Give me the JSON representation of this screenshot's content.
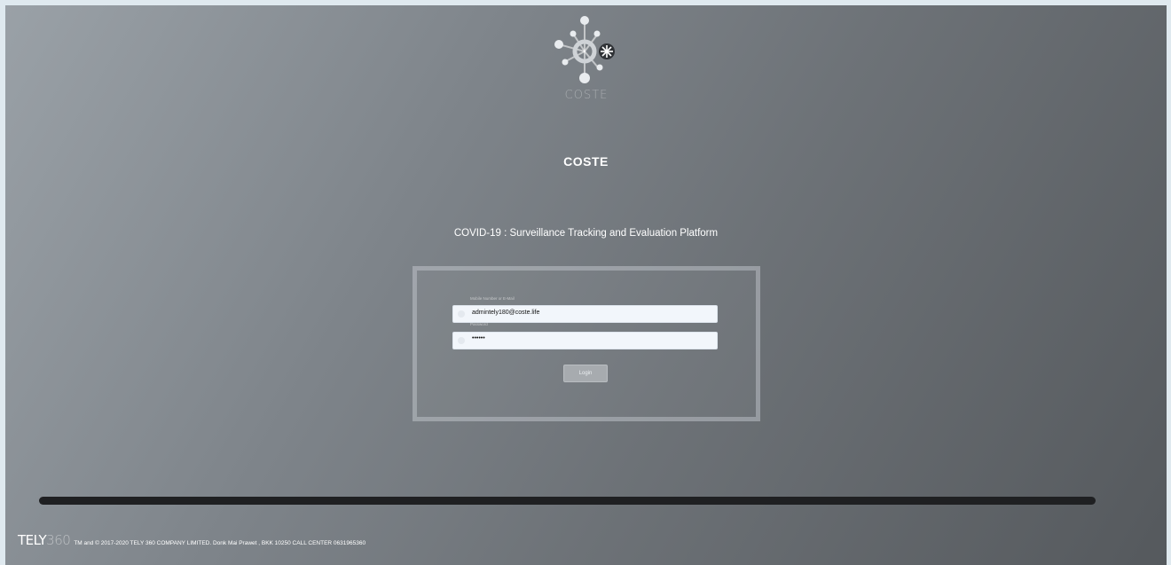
{
  "header": {
    "logo_text": "COSTE",
    "app_name": "COSTE",
    "subtitle": "COVID-19 : Surveillance Tracking and Evaluation Platform"
  },
  "login": {
    "username_label": "Mobile Number or E-Mail",
    "username_value": "admintely180@coste.life",
    "password_label": "Password",
    "password_value": "••••••",
    "login_button": "Login"
  },
  "footer": {
    "brand_bold": "TELY",
    "brand_light": "360",
    "copyright": "TM and © 2017-2020 TELY 360 COMPANY LIMITED. Donk Mai Prawet , BKK 10250 CALL CENTER 0631965360"
  },
  "colors": {
    "background_light": "#9aa1a7",
    "background_dark": "#55595d",
    "field_background": "#f2f6fb",
    "button": "#a7abaf",
    "scrollbar": "#1f2022"
  },
  "icons": {
    "logo": "coste-molecule-logo",
    "username_field": "user-icon",
    "password_field": "lock-icon"
  }
}
